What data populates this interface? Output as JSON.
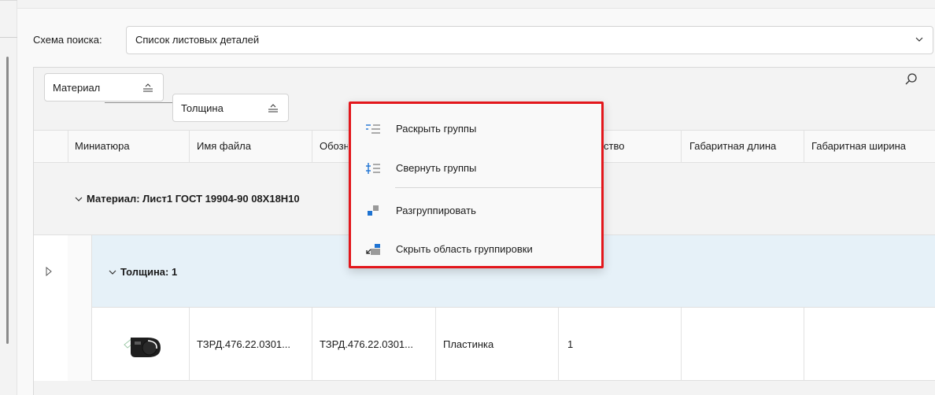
{
  "search_scheme": {
    "label": "Схема поиска:",
    "value": "Список листовых деталей"
  },
  "grouping": {
    "chips": [
      "Материал",
      "Толщина"
    ]
  },
  "columns": [
    "Миниатюра",
    "Имя файла",
    "Обозн",
    "",
    "ство",
    "Габаритная длина",
    "Габаритная ширина"
  ],
  "groups": {
    "material": "Материал: Лист1 ГОСТ 19904-90 08Х18Н10",
    "thickness": "Толщина: 1"
  },
  "row": {
    "file_name": "ТЗРД.476.22.0301...",
    "designation": "ТЗРД.476.22.0301...",
    "name": "Пластинка",
    "quantity": "1",
    "length": "",
    "width": ""
  },
  "context_menu": {
    "items": [
      "Раскрыть группы",
      "Свернуть группы",
      "Разгруппировать",
      "Скрыть область группировки"
    ]
  },
  "colors": {
    "menu_highlight_border": "#e3171c",
    "selected_group_bg": "#e6f1f8",
    "icon_blue": "#1e73d2"
  }
}
